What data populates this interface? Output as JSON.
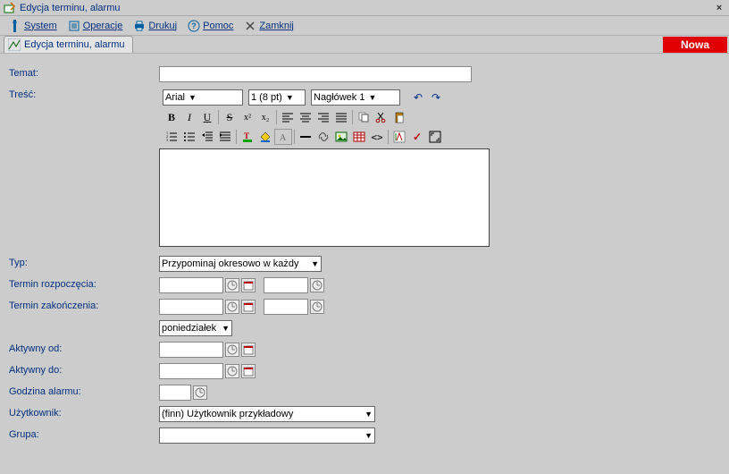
{
  "window": {
    "title": "Edycja terminu, alarmu",
    "close": "×"
  },
  "menu": {
    "system": "System",
    "operacje": "Operacje",
    "drukuj": "Drukuj",
    "pomoc": "Pomoc",
    "zamknij": "Zamknij"
  },
  "subheader": {
    "tab": "Edycja terminu, alarmu",
    "badge": "Nowa"
  },
  "labels": {
    "temat": "Temat:",
    "tresc": "Treść:",
    "typ": "Typ:",
    "termin_rozp": "Termin rozpoczęcia:",
    "termin_zak": "Termin zakończenia:",
    "aktywny_od": "Aktywny od:",
    "aktywny_do": "Aktywny do:",
    "godzina_alarmu": "Godzina alarmu:",
    "uzytkownik": "Użytkownik:",
    "grupa": "Grupa:"
  },
  "editor": {
    "font": "Arial",
    "size": "1 (8 pt)",
    "heading": "Nagłówek 1"
  },
  "fields": {
    "temat": "",
    "typ_selected": "Przypominaj okresowo w każdy",
    "day_selected": "poniedziałek",
    "user_selected": "(finn) Użytkownik przykładowy",
    "group_selected": "",
    "start_date": "",
    "start_time": "",
    "end_date": "",
    "end_time": "",
    "active_from": "",
    "active_to": "",
    "alarm_time": ""
  }
}
